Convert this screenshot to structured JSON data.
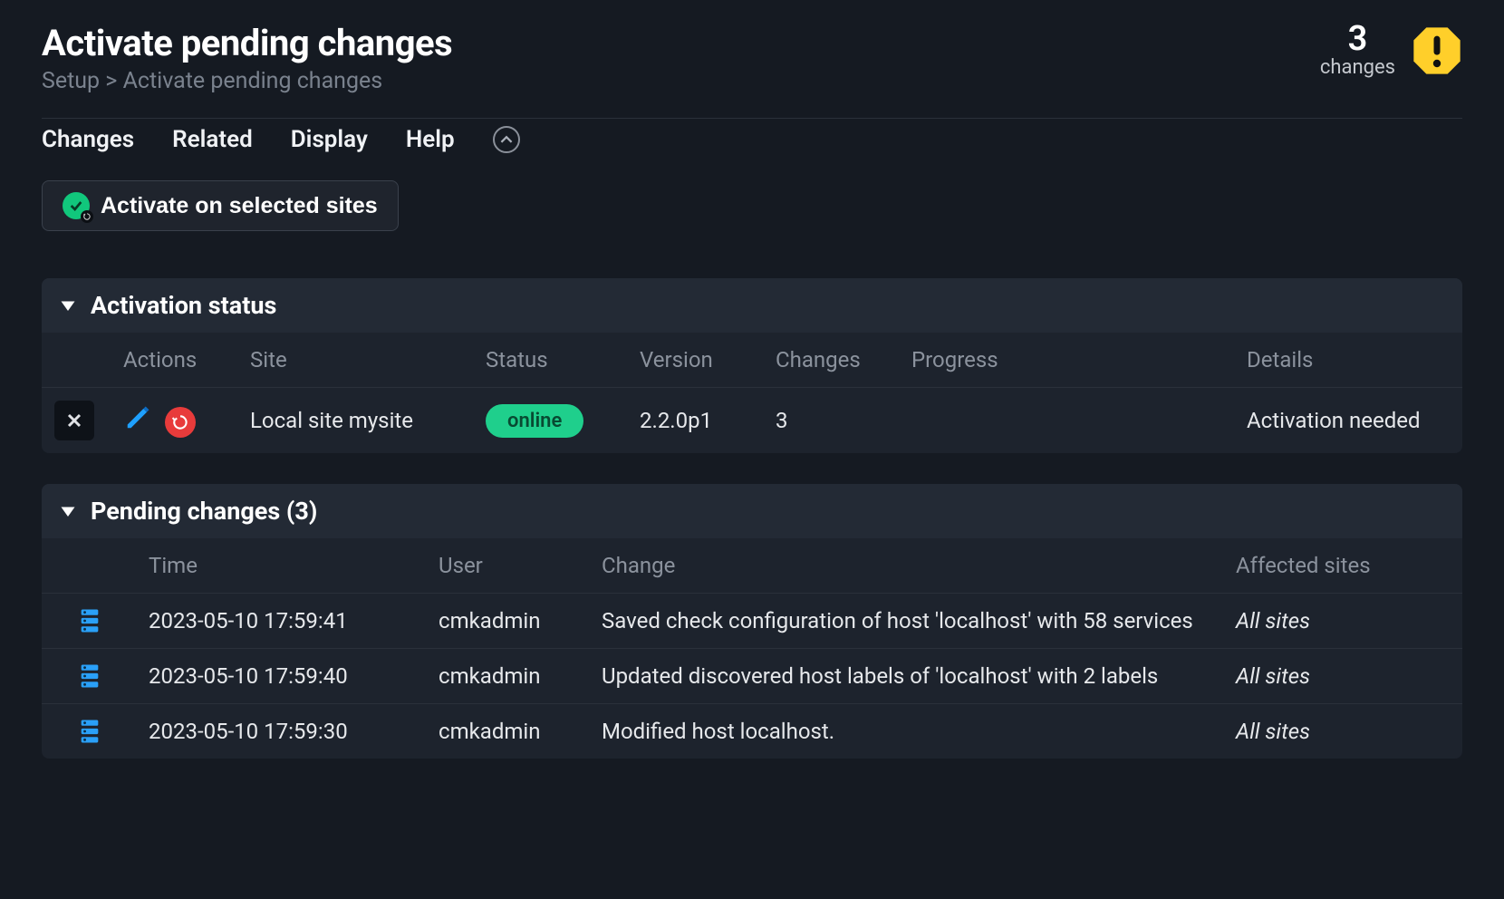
{
  "header": {
    "title": "Activate pending changes",
    "breadcrumb": "Setup > Activate pending changes",
    "changes_count": "3",
    "changes_label": "changes"
  },
  "menubar": {
    "items": [
      "Changes",
      "Related",
      "Display",
      "Help"
    ]
  },
  "toolbar": {
    "activate_label": "Activate on selected sites"
  },
  "status_panel": {
    "title": "Activation status",
    "columns": {
      "actions": "Actions",
      "site": "Site",
      "status": "Status",
      "version": "Version",
      "changes": "Changes",
      "progress": "Progress",
      "details": "Details"
    },
    "rows": [
      {
        "site": "Local site mysite",
        "status_label": "online",
        "version": "2.2.0p1",
        "changes": "3",
        "progress": "",
        "details": "Activation needed"
      }
    ]
  },
  "pending_panel": {
    "title": "Pending changes (3)",
    "columns": {
      "time": "Time",
      "user": "User",
      "change": "Change",
      "affected": "Affected sites"
    },
    "rows": [
      {
        "time": "2023-05-10 17:59:41",
        "user": "cmkadmin",
        "change": "Saved check configuration of host 'localhost' with 58 services",
        "affected": "All sites"
      },
      {
        "time": "2023-05-10 17:59:40",
        "user": "cmkadmin",
        "change": "Updated discovered host labels of 'localhost' with 2 labels",
        "affected": "All sites"
      },
      {
        "time": "2023-05-10 17:59:30",
        "user": "cmkadmin",
        "change": "Modified host localhost.",
        "affected": "All sites"
      }
    ]
  }
}
